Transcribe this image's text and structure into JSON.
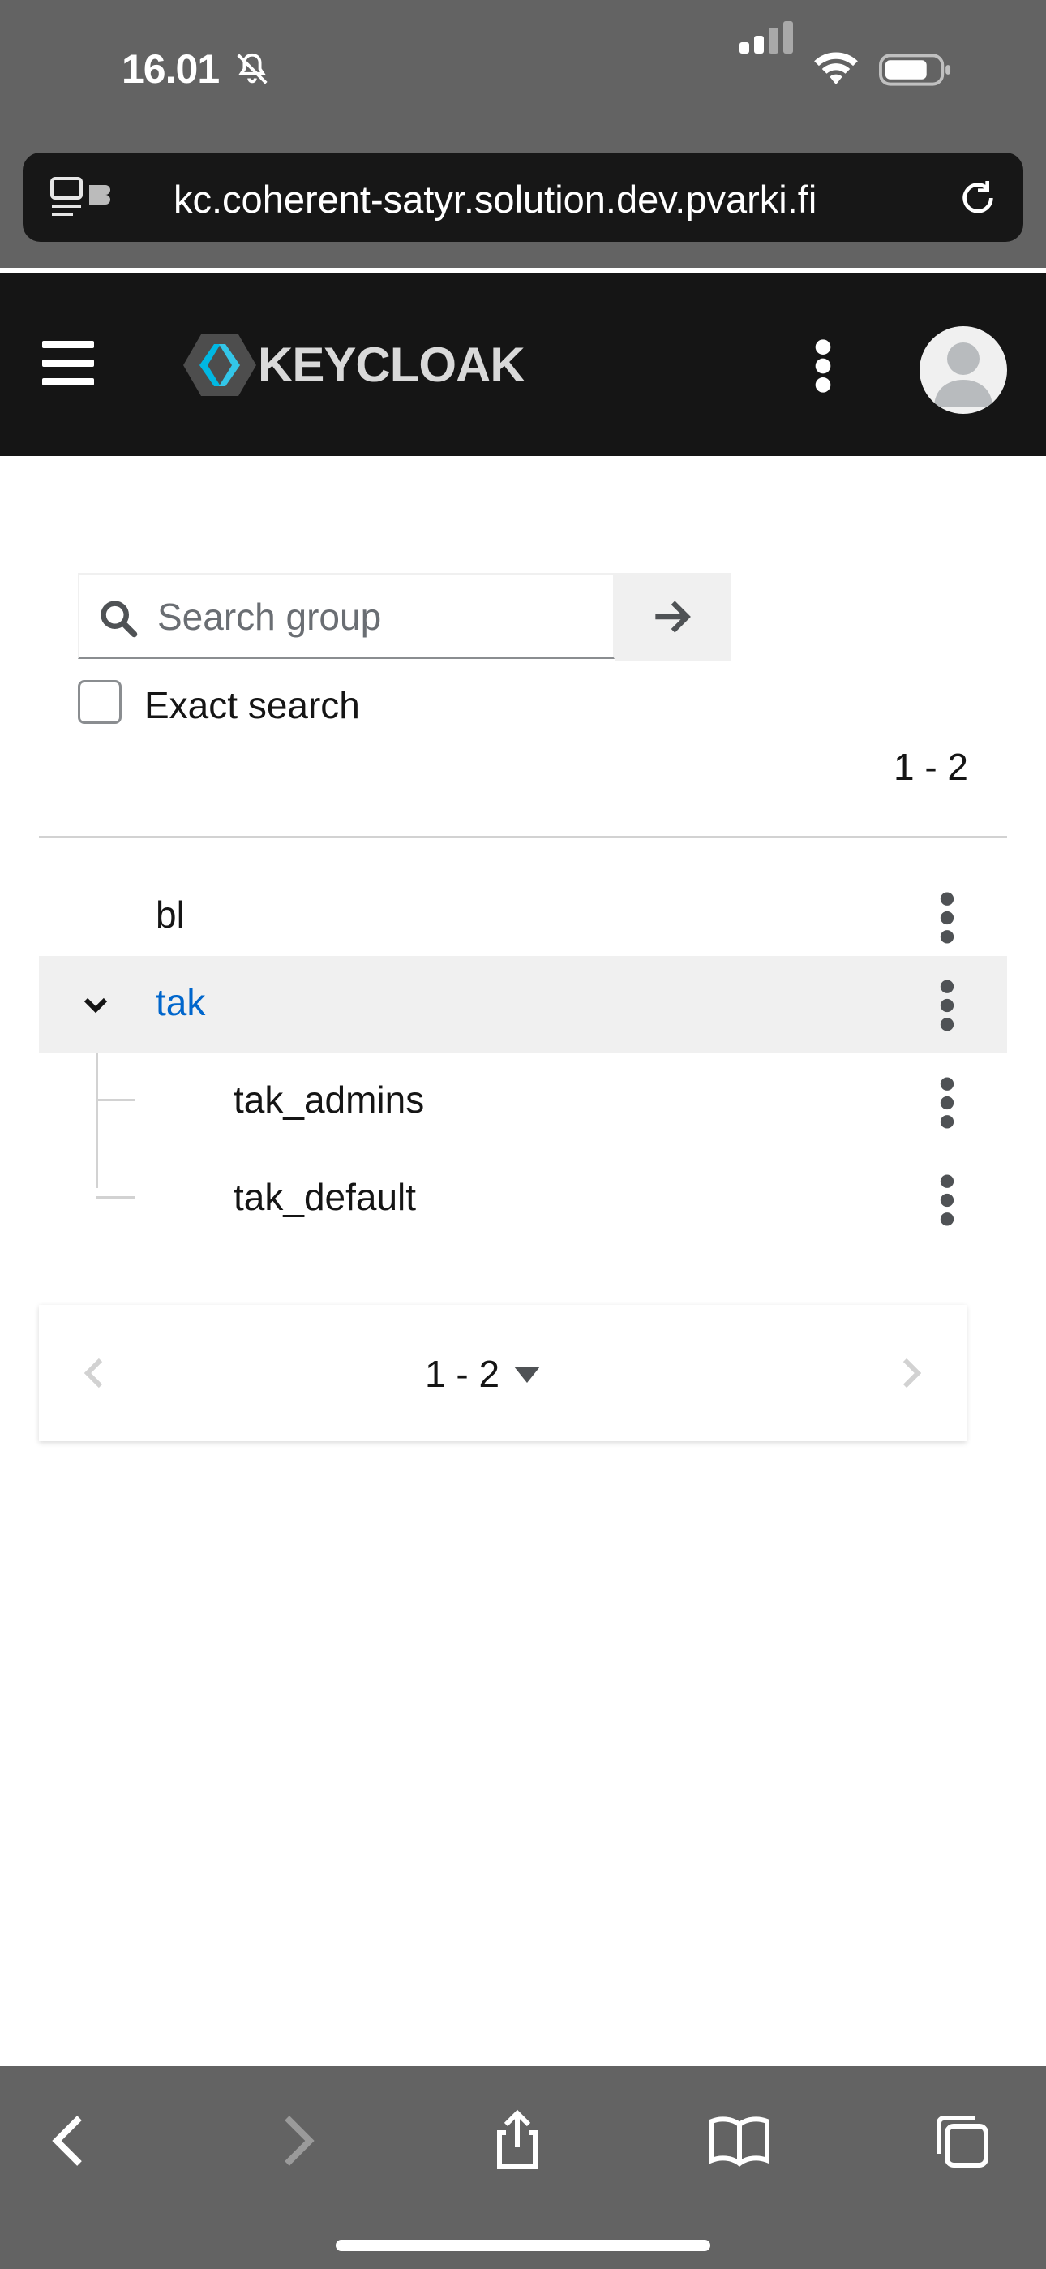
{
  "status_bar": {
    "time": "16.01"
  },
  "browser": {
    "url": "kc.coherent-satyr.solution.dev.pvarki.fi"
  },
  "masthead": {
    "brand": "KEYCLOAK"
  },
  "search": {
    "placeholder": "Search group",
    "exact_label": "Exact search"
  },
  "pagination_top": {
    "range": "1 - 2"
  },
  "groups": [
    {
      "name": "bl",
      "level": 0
    },
    {
      "name": "tak",
      "level": 0,
      "expanded": true,
      "selected": true
    },
    {
      "name": "tak_admins",
      "level": 1
    },
    {
      "name": "tak_default",
      "level": 1
    }
  ],
  "pagination_bottom": {
    "range": "1 - 2"
  },
  "colors": {
    "masthead": "#151515",
    "link": "#0066cc",
    "selected_row": "#f0f0f0"
  }
}
